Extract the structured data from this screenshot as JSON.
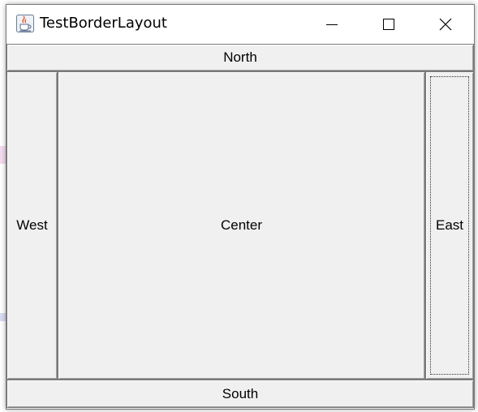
{
  "window": {
    "title": "TestBorderLayout",
    "app_icon": "java-cup-icon",
    "controls": {
      "minimize_icon": "minimize-icon",
      "maximize_icon": "maximize-icon",
      "close_icon": "close-icon"
    }
  },
  "layout": {
    "north": "North",
    "west": "West",
    "center": "Center",
    "east": "East",
    "south": "South",
    "focused_region": "east"
  },
  "colors": {
    "panel_background": "#f0f0f0",
    "titlebar_background": "#ffffff",
    "button_border": "#7a7a7a"
  }
}
